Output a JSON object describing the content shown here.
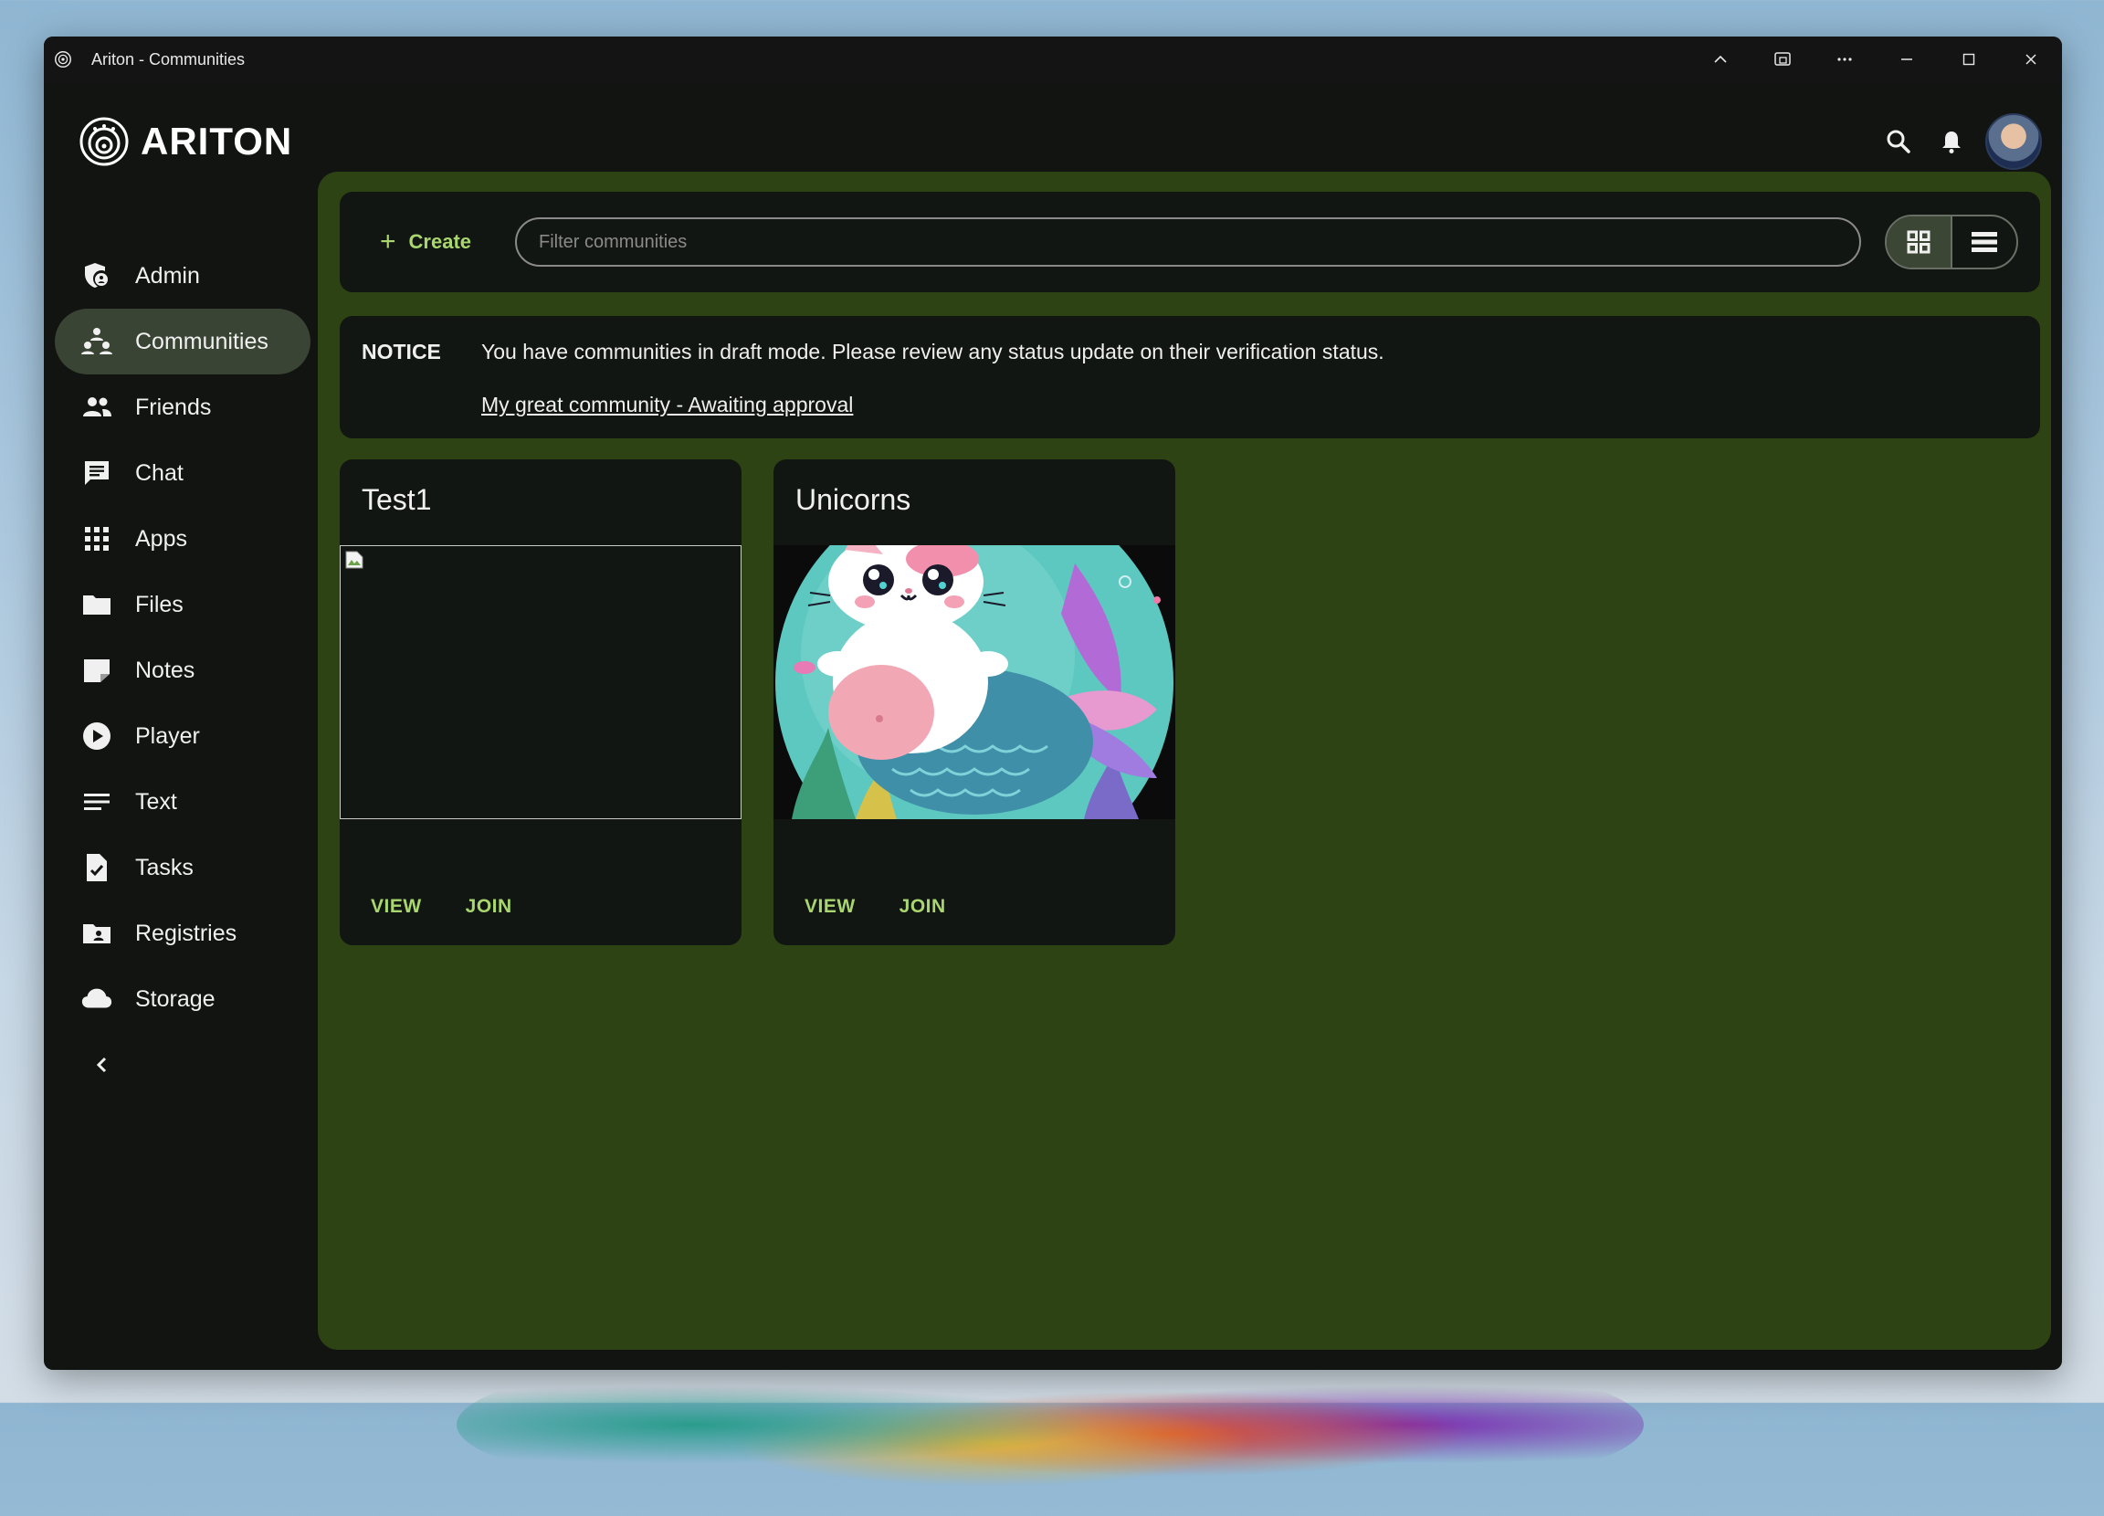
{
  "window": {
    "title": "Ariton - Communities"
  },
  "brand": {
    "name": "ARITON"
  },
  "sidebar": {
    "items": [
      {
        "label": "Admin",
        "icon": "admin-shield-icon"
      },
      {
        "label": "Communities",
        "icon": "communities-icon",
        "active": true
      },
      {
        "label": "Friends",
        "icon": "friends-icon"
      },
      {
        "label": "Chat",
        "icon": "chat-icon"
      },
      {
        "label": "Apps",
        "icon": "apps-grid-icon"
      },
      {
        "label": "Files",
        "icon": "folder-icon"
      },
      {
        "label": "Notes",
        "icon": "note-icon"
      },
      {
        "label": "Player",
        "icon": "play-icon"
      },
      {
        "label": "Text",
        "icon": "text-lines-icon"
      },
      {
        "label": "Tasks",
        "icon": "task-check-icon"
      },
      {
        "label": "Registries",
        "icon": "registry-icon"
      },
      {
        "label": "Storage",
        "icon": "cloud-icon"
      }
    ]
  },
  "toolbar": {
    "create_label": "Create",
    "filter_placeholder": "Filter communities",
    "filter_value": ""
  },
  "notice": {
    "label": "NOTICE",
    "message": "You have communities in draft mode. Please review any status update on their verification status.",
    "link_text": "My great community - Awaiting approval"
  },
  "cards": [
    {
      "title": "Test1",
      "view_label": "VIEW",
      "join_label": "JOIN"
    },
    {
      "title": "Unicorns",
      "view_label": "VIEW",
      "join_label": "JOIN"
    }
  ],
  "colors": {
    "accent": "#a9d66e",
    "content_bg": "#2e4313",
    "panel_bg": "#121612"
  }
}
